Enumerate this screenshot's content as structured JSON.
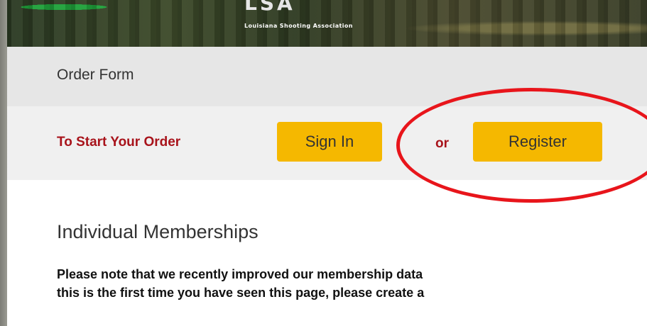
{
  "header": {
    "logo_letters": "LSA",
    "logo_subtitle": "Louisiana Shooting Association"
  },
  "title_bar": {
    "title": "Order Form"
  },
  "order_bar": {
    "prompt": "To Start Your Order",
    "sign_in_label": "Sign In",
    "or_label": "or",
    "register_label": "Register"
  },
  "content": {
    "section_title": "Individual Memberships",
    "notice_line1": "Please note that we recently improved our membership data",
    "notice_line2": "this is the first time you have seen this page, please create a"
  },
  "colors": {
    "accent_button": "#f5b800",
    "prompt_red": "#a8131b",
    "annotation_ring": "#e8151b"
  }
}
